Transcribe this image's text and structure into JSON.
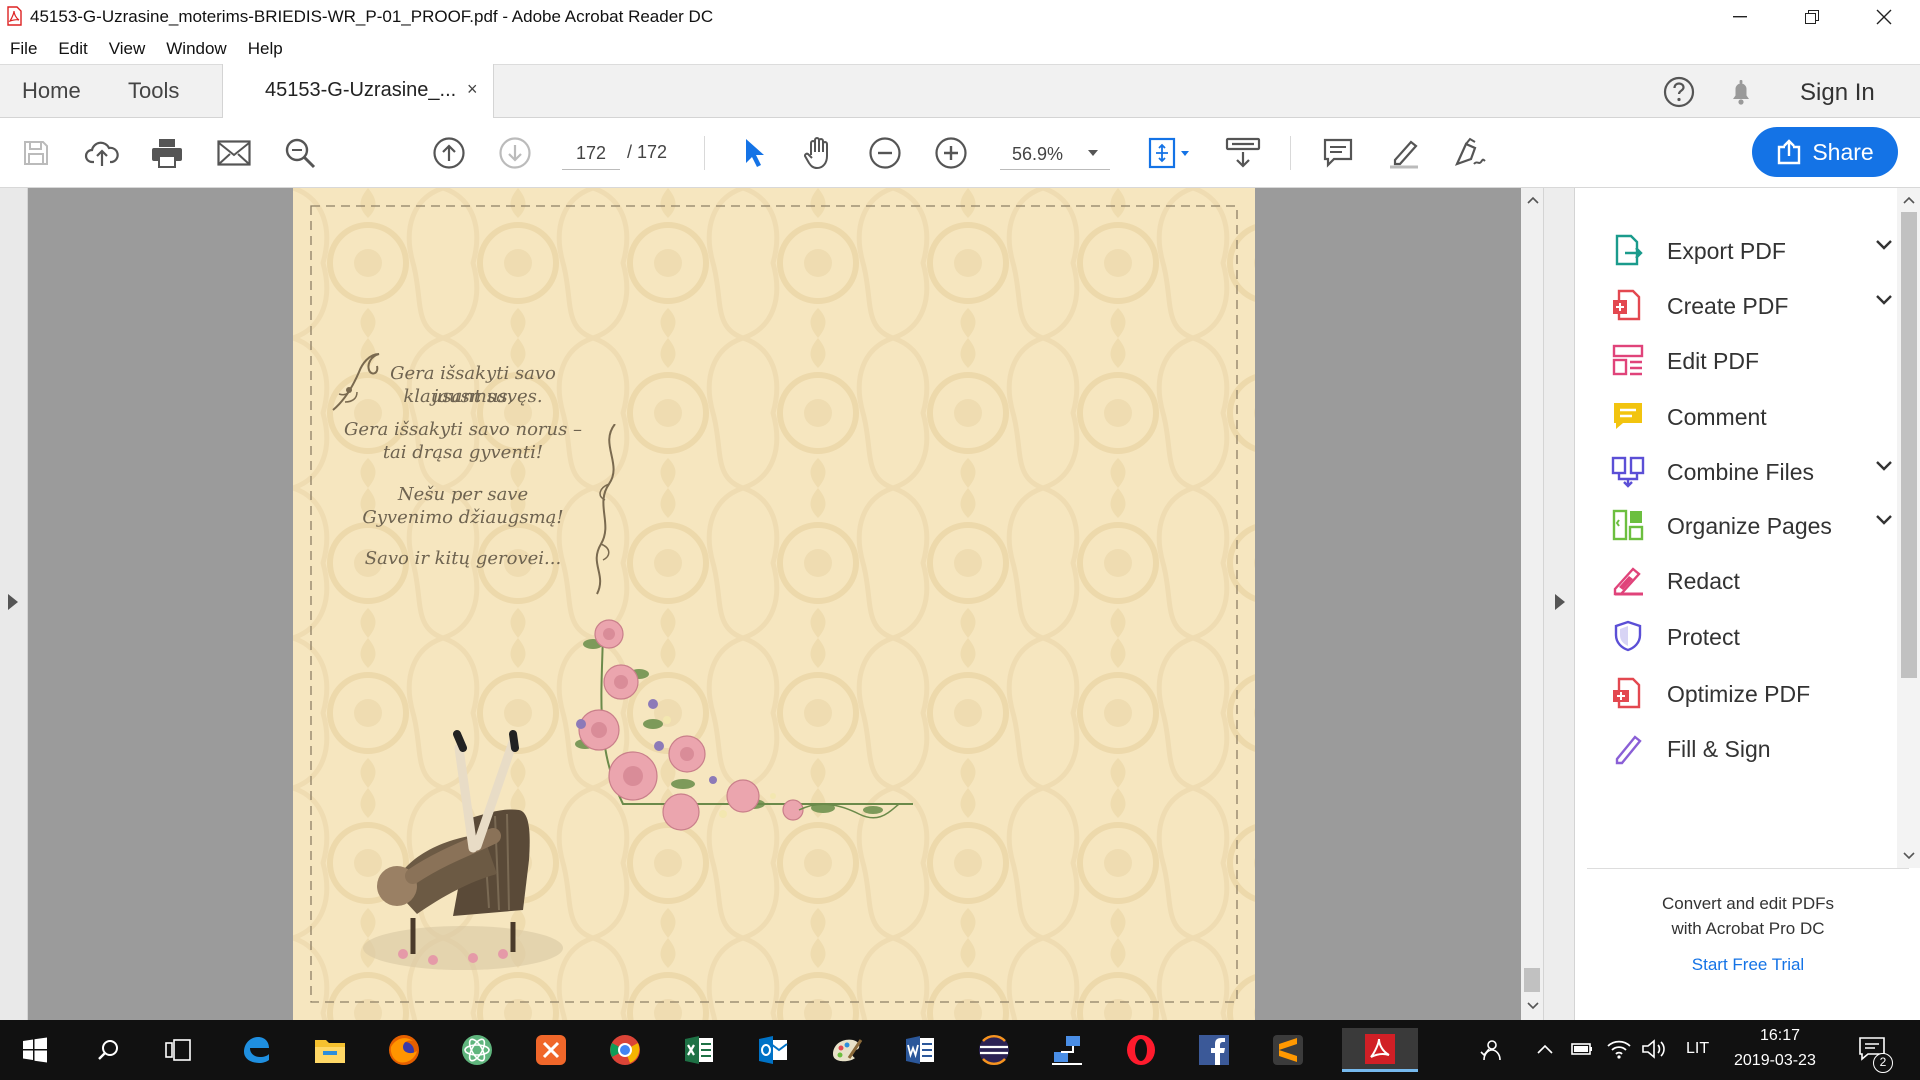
{
  "window": {
    "title": "45153-G-Uzrasine_moterims-BRIEDIS-WR_P-01_PROOF.pdf - Adobe Acrobat Reader DC"
  },
  "menu": [
    "File",
    "Edit",
    "View",
    "Window",
    "Help"
  ],
  "tabs": {
    "home": "Home",
    "tools": "Tools",
    "document": "45153-G-Uzrasine_...",
    "close": "×"
  },
  "header": {
    "sign_in": "Sign In"
  },
  "toolbar": {
    "current_page": "172",
    "page_separator": "/ 172",
    "zoom": "56.9%",
    "share_label": "Share"
  },
  "document_text": {
    "line1": "Gera išsakyti savo jausmus,",
    "line2": "klausant savęs.",
    "line3": "Gera išsakyti savo norus –",
    "line4": "tai drąsa gyventi!",
    "line5": "Nešu per save",
    "line6": "Gyvenimo džiaugsmą!",
    "line7": "Savo ir kitų gerovei..."
  },
  "tools_panel": [
    {
      "label": "Export PDF",
      "icon": "export-pdf-icon",
      "color": "#1a9b8c",
      "has_menu": true
    },
    {
      "label": "Create PDF",
      "icon": "create-pdf-icon",
      "color": "#e34850",
      "has_menu": true
    },
    {
      "label": "Edit PDF",
      "icon": "edit-pdf-icon",
      "color": "#e0437a",
      "has_menu": false
    },
    {
      "label": "Comment",
      "icon": "comment-icon",
      "color": "#f2c40f",
      "has_menu": false
    },
    {
      "label": "Combine Files",
      "icon": "combine-files-icon",
      "color": "#5b4fd6",
      "has_menu": true
    },
    {
      "label": "Organize Pages",
      "icon": "organize-pages-icon",
      "color": "#6cbf3f",
      "has_menu": true
    },
    {
      "label": "Redact",
      "icon": "redact-icon",
      "color": "#e0437a",
      "has_menu": false
    },
    {
      "label": "Protect",
      "icon": "protect-icon",
      "color": "#5b4fd6",
      "has_menu": false
    },
    {
      "label": "Optimize PDF",
      "icon": "optimize-pdf-icon",
      "color": "#e34850",
      "has_menu": false
    },
    {
      "label": "Fill & Sign",
      "icon": "fill-sign-icon",
      "color": "#8a5fd6",
      "has_menu": false
    }
  ],
  "promo": {
    "text": "Convert and edit PDFs with Acrobat Pro DC",
    "link": "Start Free Trial"
  },
  "taskbar": {
    "language": "LIT",
    "time": "16:17",
    "date": "2019-03-23",
    "notifications": "2"
  }
}
